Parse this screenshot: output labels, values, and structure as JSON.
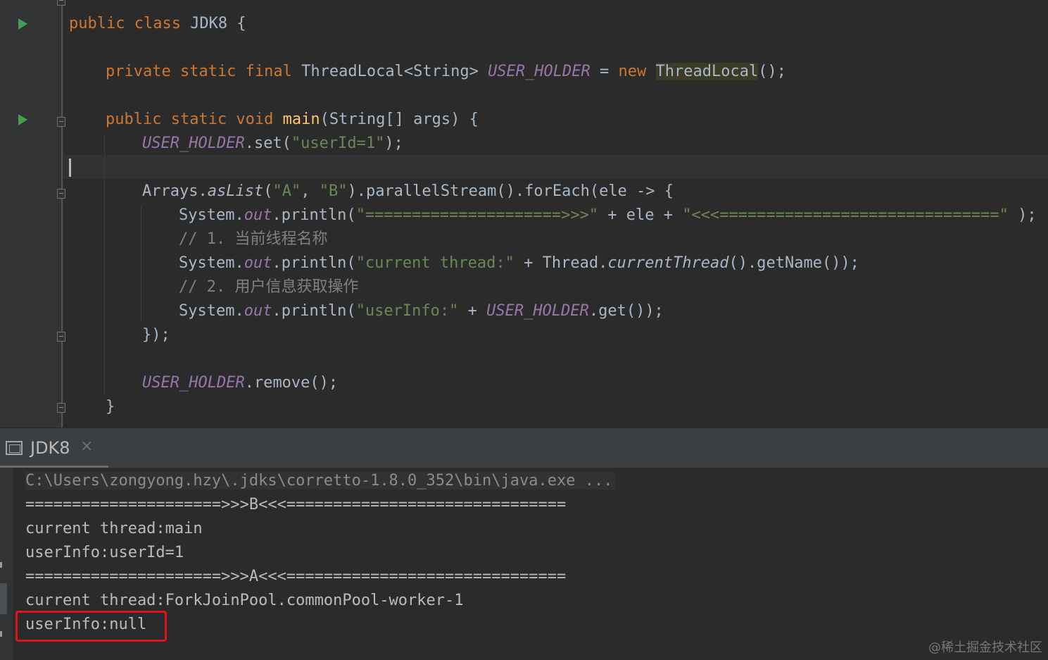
{
  "editor": {
    "lines": {
      "class_decl": {
        "kw": "public class ",
        "name": "JDK8 {"
      },
      "field_decl": {
        "kw": "private static final ",
        "type": "ThreadLocal<String> ",
        "field": "USER_HOLDER",
        "eq": " = ",
        "new_kw": "new ",
        "ctor": "ThreadLocal",
        "rest": "();"
      },
      "main_decl": {
        "kw": "public static void ",
        "name": "main",
        "rest": "(String[] args) {"
      },
      "set_call": {
        "field": "USER_HOLDER",
        "method": ".set(",
        "arg": "\"userId=1\"",
        "end": ");"
      },
      "stream_call": {
        "obj": "Arrays.",
        "method": "asList",
        "open": "(",
        "a": "\"A\"",
        "comma": ", ",
        "b": "\"B\"",
        "rest": ").parallelStream().forEach(ele -> {"
      },
      "print_sep": {
        "obj": "System.",
        "out": "out",
        "call": ".println(",
        "s1": "\"=====================>>>\"",
        "mid": " + ele + ",
        "s2": "\"<<<==============================\"",
        "end": " );"
      },
      "comment1": "// 1. 当前线程名称",
      "print_thread": {
        "obj": "System.",
        "out": "out",
        "call": ".println(",
        "s1": "\"current thread:\"",
        "mid": " + Thread.",
        "method": "currentThread",
        "end": "().getName());"
      },
      "comment2": "// 2. 用户信息获取操作",
      "print_user": {
        "obj": "System.",
        "out": "out",
        "call": ".println(",
        "s1": "\"userInfo:\"",
        "mid": " + ",
        "field": "USER_HOLDER",
        "end": ".get());"
      },
      "lambda_close": "});",
      "remove_call": {
        "field": "USER_HOLDER",
        "end": ".remove();"
      },
      "main_close": "}"
    }
  },
  "run_panel": {
    "tab_label": "JDK8",
    "close_glyph": "×"
  },
  "console": {
    "lines": [
      "C:\\Users\\zongyong.hzy\\.jdks\\corretto-1.8.0_352\\bin\\java.exe ...",
      "=====================>>>B<<<==============================",
      "current thread:main",
      "userInfo:userId=1",
      "=====================>>>A<<<==============================",
      "current thread:ForkJoinPool.commonPool-worker-1",
      "userInfo:null"
    ]
  },
  "watermark": "@稀土掘金技术社区",
  "colors": {
    "keyword": "#cc7832",
    "string": "#6a8759",
    "static_field": "#9876aa",
    "method_decl": "#ffc66d",
    "comment": "#808080",
    "highlight_box": "#e0141a"
  }
}
